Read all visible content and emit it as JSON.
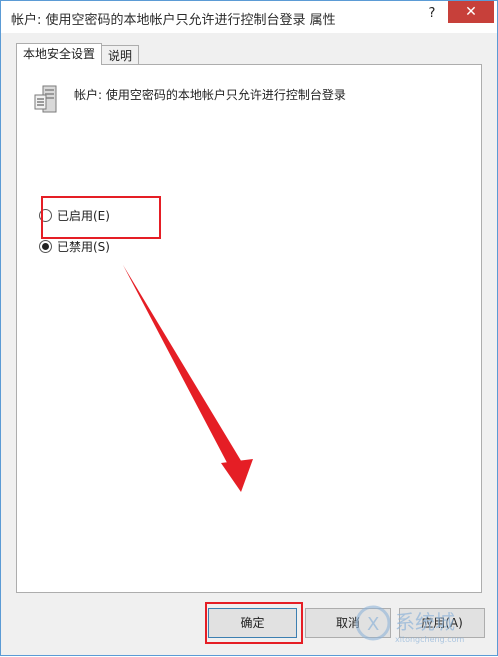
{
  "window": {
    "title": "帐户: 使用空密码的本地帐户只允许进行控制台登录 属性",
    "help_glyph": "?",
    "close_glyph": "✕"
  },
  "tabs": [
    {
      "label": "本地安全设置",
      "active": true
    },
    {
      "label": "说明",
      "active": false
    }
  ],
  "policy": {
    "title": "帐户: 使用空密码的本地帐户只允许进行控制台登录",
    "icon": "server-policy-icon"
  },
  "options": [
    {
      "label": "已启用(E)",
      "checked": false
    },
    {
      "label": "已禁用(S)",
      "checked": true
    }
  ],
  "buttons": {
    "ok": "确定",
    "cancel": "取消",
    "apply": "应用(A)"
  },
  "watermark": {
    "brand": "系统城",
    "site": "xitongcheng.com"
  },
  "colors": {
    "accent_border": "#5b9bd5",
    "close_button": "#c7403a",
    "annotation_red": "#e51e25"
  }
}
